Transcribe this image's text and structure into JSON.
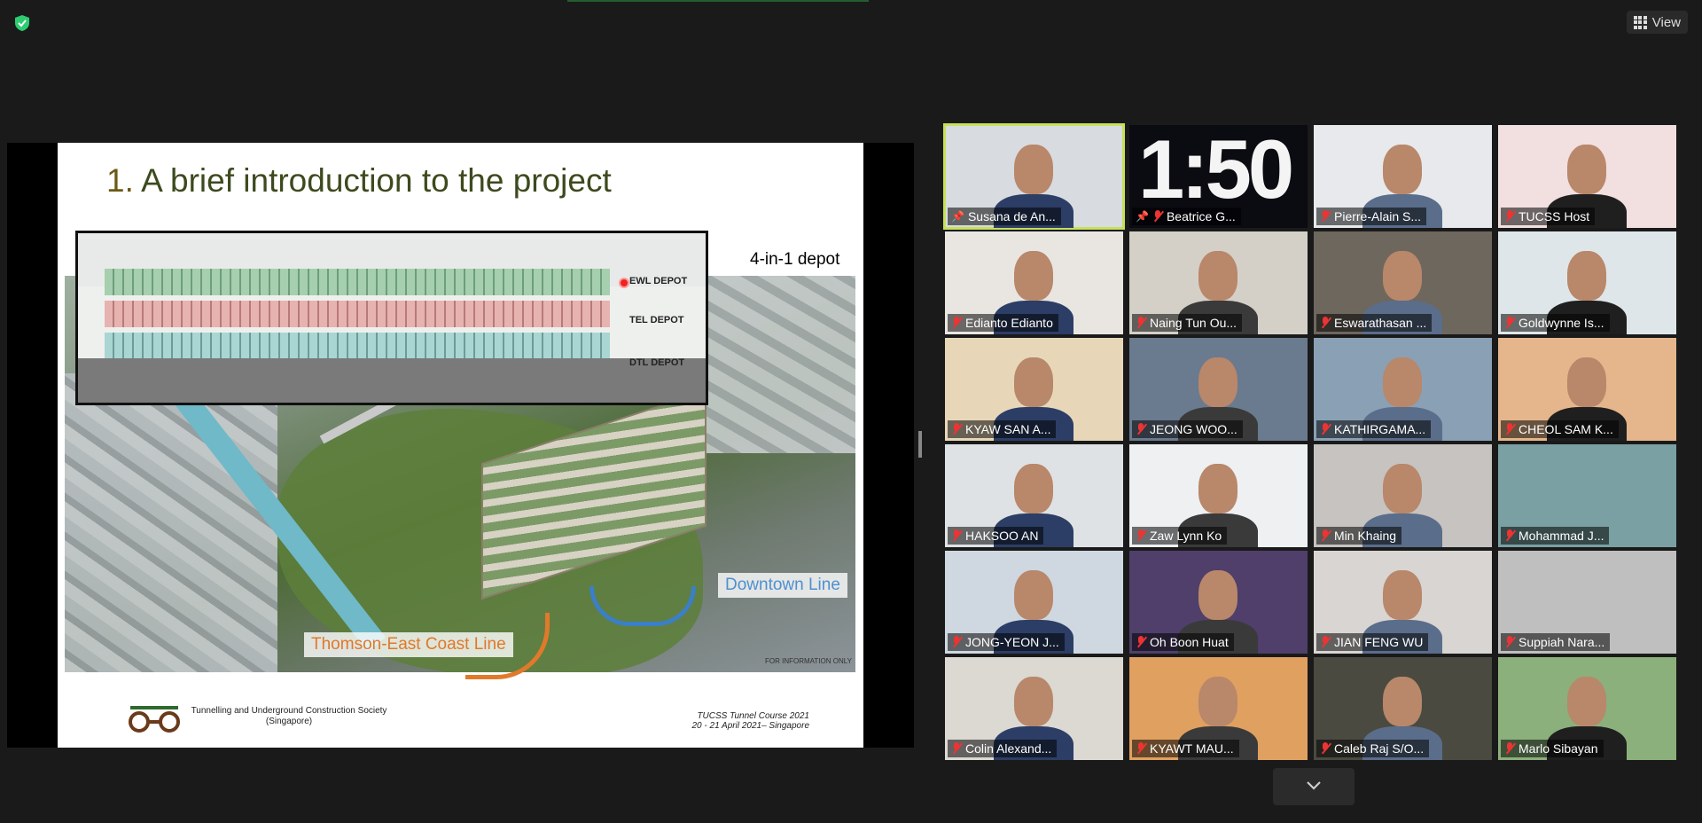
{
  "toolbar": {
    "view_label": "View"
  },
  "slide": {
    "title_number": "1.",
    "title_text": "A brief introduction to the project",
    "depot_caption": "4-in-1 depot",
    "section_labels": [
      "EWL DEPOT",
      "TEL DEPOT",
      "DTL DEPOT"
    ],
    "line_downtown": "Downtown Line",
    "line_thomson": "Thomson-East Coast Line",
    "fyi_note": "FOR INFORMATION ONLY",
    "org_name": "Tunnelling and Underground Construction Society",
    "org_country": "(Singapore)",
    "course_name": "TUCSS Tunnel Course 2021",
    "course_date": "20 - 21 April 2021– Singapore"
  },
  "colors": {
    "active_speaker": "#c6e05a",
    "muted": "#e33333",
    "secure": "#2ecc71"
  },
  "participants": [
    {
      "name": "Susana de An...",
      "muted": false,
      "pinned": true,
      "active": true
    },
    {
      "name": "Beatrice G...",
      "muted": true,
      "pinned": true,
      "clock": "1:50"
    },
    {
      "name": "Pierre-Alain S...",
      "muted": true
    },
    {
      "name": "TUCSS Host",
      "muted": true
    },
    {
      "name": "Edianto Edianto",
      "muted": true
    },
    {
      "name": "Naing Tun Ou...",
      "muted": true
    },
    {
      "name": "Eswarathasan ...",
      "muted": true
    },
    {
      "name": "Goldwynne Is...",
      "muted": true
    },
    {
      "name": "KYAW SAN A...",
      "muted": true
    },
    {
      "name": "JEONG WOO...",
      "muted": true
    },
    {
      "name": "KATHIRGAMA...",
      "muted": true
    },
    {
      "name": "CHEOL SAM K...",
      "muted": true
    },
    {
      "name": "HAKSOO AN",
      "muted": true
    },
    {
      "name": "Zaw Lynn Ko",
      "muted": true
    },
    {
      "name": "Min Khaing",
      "muted": true
    },
    {
      "name": "Mohammad J...",
      "muted": true
    },
    {
      "name": "JONG-YEON J...",
      "muted": true
    },
    {
      "name": "Oh Boon Huat",
      "muted": true
    },
    {
      "name": "JIAN FENG WU",
      "muted": true
    },
    {
      "name": "Suppiah Nara...",
      "muted": true
    },
    {
      "name": "Colin Alexand...",
      "muted": true
    },
    {
      "name": "KYAWT MAU...",
      "muted": true
    },
    {
      "name": "Caleb Raj S/O...",
      "muted": true
    },
    {
      "name": "Marlo Sibayan",
      "muted": true
    }
  ]
}
